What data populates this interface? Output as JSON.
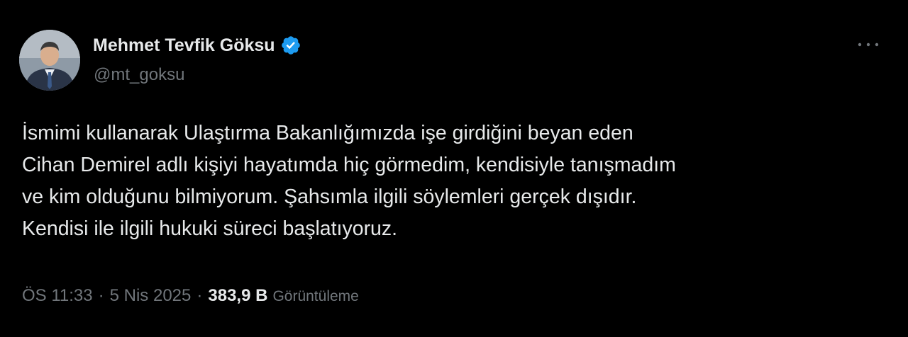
{
  "author": {
    "display_name": "Mehmet Tevfik Göksu",
    "handle": "@mt_goksu",
    "verified": true,
    "verified_color": "#1d9bf0"
  },
  "tweet": {
    "lines": [
      "İsmimi kullanarak Ulaştırma Bakanlığımızda işe girdiğini beyan eden",
      "Cihan Demirel adlı kişiyi hayatımda hiç görmedim, kendisiyle tanışmadım",
      "ve kim olduğunu bilmiyorum. Şahsımla ilgili söylemleri gerçek dışıdır.",
      "Kendisi ile ilgili hukuki süreci başlatıyoruz."
    ]
  },
  "meta": {
    "time": "ÖS 11:33",
    "separator": "·",
    "date": "5 Nis 2025",
    "views_count": "383,9 B",
    "views_label": "Görüntüleme"
  },
  "icons": {
    "more": "more-horizontal-icon",
    "verified": "verified-badge-icon"
  },
  "colors": {
    "background": "#000000",
    "text_primary": "#e7e9ea",
    "text_secondary": "#71767b"
  }
}
